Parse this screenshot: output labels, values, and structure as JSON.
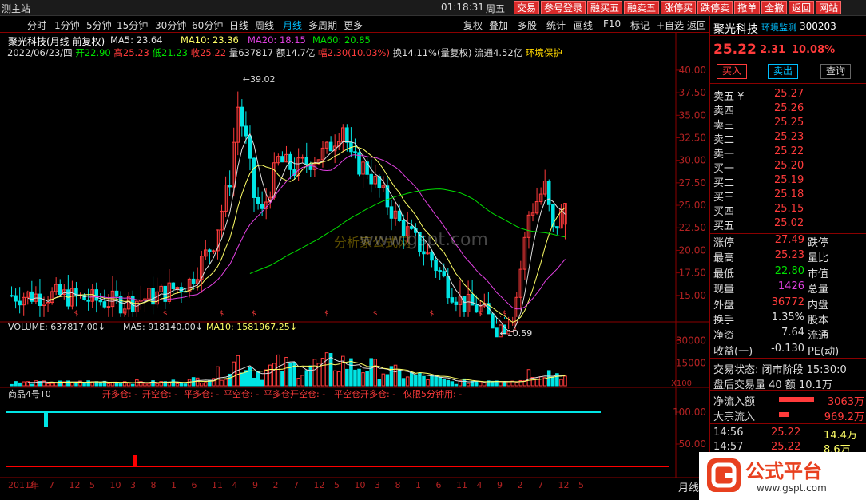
{
  "topbar": {
    "station": "测主站",
    "clock": "01:18:31",
    "weekday": "周五",
    "buttons": [
      "交易",
      "参号登录",
      "融买五",
      "融卖五",
      "涨停买",
      "跌停卖",
      "撤单",
      "全撤",
      "返回",
      "网站"
    ]
  },
  "periods": [
    {
      "label": "分时",
      "active": false
    },
    {
      "label": "1分钟",
      "active": false
    },
    {
      "label": "5分钟",
      "active": false
    },
    {
      "label": "15分钟",
      "active": false
    },
    {
      "label": "30分钟",
      "active": false
    },
    {
      "label": "60分钟",
      "active": false
    },
    {
      "label": "日线",
      "active": false
    },
    {
      "label": "周线",
      "active": false
    },
    {
      "label": "月线",
      "active": true
    },
    {
      "label": "多周期",
      "active": false
    },
    {
      "label": "更多",
      "active": false
    },
    {
      "label": "复权",
      "active": false
    },
    {
      "label": "叠加",
      "active": false
    },
    {
      "label": "多股",
      "active": false
    },
    {
      "label": "统计",
      "active": false
    },
    {
      "label": "画线",
      "active": false
    },
    {
      "label": "F10",
      "active": false
    },
    {
      "label": "标记",
      "active": false
    },
    {
      "label": "+自选",
      "active": false
    },
    {
      "label": "返回",
      "active": false
    }
  ],
  "chart_header": {
    "title": "聚光科技(月线 前复权)",
    "ma5": "MA5: 23.64",
    "ma10": "MA10: 23.36",
    "ma20": "MA20: 18.15",
    "ma60": "MA60: 20.85",
    "date": "2022/06/23/四",
    "open": "开22.90",
    "high": "高25.23",
    "low": "低21.23",
    "close": "收25.22",
    "volume": "量637817",
    "amount": "额14.7亿",
    "range": "幅2.30(10.03%)",
    "turnover": "换14.11%(量复权)",
    "float": "流通4.52亿",
    "env": "环境保护"
  },
  "watermark": {
    "site": "www.gspt.com",
    "text": "分析家公式网",
    "brand": "公式平台",
    "url": "www.gspt.com"
  },
  "volume_header": {
    "label": "VOLUME: 637817.00",
    "ma5": "MA5: 918140.00",
    "ma10": "MA10: 1581967.25"
  },
  "signal_header": {
    "label": "商品4号T0",
    "items": [
      "开多仓: -",
      "开空仓: -",
      "平多仓: -",
      "平空仓: -",
      "平多仓开空仓: -",
      "平空仓开多仓: -",
      "仅限5分钟用: -"
    ]
  },
  "chart_data": {
    "type": "candlestick",
    "title": "聚光科技(月线 前复权)",
    "ylim": [
      12.5,
      41.5
    ],
    "y_ticks": [
      15.0,
      17.5,
      20.0,
      22.5,
      25.0,
      27.5,
      30.0,
      32.5,
      35.0,
      37.5,
      40.0
    ],
    "annotations": [
      {
        "text": "39.02",
        "value": 39.02
      },
      {
        "text": "10.59",
        "value": 10.59
      }
    ],
    "volume_ticks": [
      15000,
      30000
    ],
    "volume_unit": "X100",
    "signal_ticks": [
      50.0,
      100.0
    ],
    "x_labels": [
      "2011年",
      "2",
      "7",
      "12",
      "5",
      "10",
      "3",
      "8",
      "1",
      "6",
      "11",
      "4",
      "9",
      "2",
      "7",
      "12",
      "5",
      "10",
      "3",
      "8",
      "1",
      "6",
      "11",
      "4",
      "9",
      "2",
      "7",
      "12",
      "5"
    ],
    "ohlc": []
  },
  "right_panel": {
    "name": "聚光科技",
    "env": "环境监测",
    "code": "300203",
    "price": "25.22",
    "change": "2.31",
    "pct": "10.08%",
    "buttons": [
      "买入",
      "卖出",
      "查询"
    ],
    "asks": [
      {
        "label": "卖五 ¥",
        "price": "25.27"
      },
      {
        "label": "卖四",
        "price": "25.26"
      },
      {
        "label": "卖三",
        "price": "25.25"
      },
      {
        "label": "卖二",
        "price": "25.23"
      },
      {
        "label": "卖一",
        "price": "25.22"
      }
    ],
    "bids": [
      {
        "label": "买一",
        "price": "25.20"
      },
      {
        "label": "买二",
        "price": "25.19"
      },
      {
        "label": "买三",
        "price": "25.18"
      },
      {
        "label": "买四",
        "price": "25.15"
      },
      {
        "label": "买五",
        "price": "25.02"
      }
    ],
    "stats": [
      {
        "l1": "涨停",
        "v1": "27.49",
        "c1": "#ff3b3b",
        "l2": "跌停"
      },
      {
        "l1": "最高",
        "v1": "25.23",
        "c1": "#ff3b3b",
        "l2": "量比"
      },
      {
        "l1": "最低",
        "v1": "22.80",
        "c1": "#00e000",
        "l2": "市值"
      },
      {
        "l1": "现量",
        "v1": "1426",
        "c1": "#e040e0",
        "l2": "总量"
      },
      {
        "l1": "外盘",
        "v1": "36772",
        "c1": "#ff3b3b",
        "l2": "内盘"
      },
      {
        "l1": "换手",
        "v1": "1.35%",
        "c1": "#ddd",
        "l2": "股本"
      },
      {
        "l1": "净资",
        "v1": "7.64",
        "c1": "#ddd",
        "l2": "流通"
      },
      {
        "l1": "收益(一)",
        "v1": "-0.130",
        "c1": "#ddd",
        "l2": "PE(动)"
      }
    ],
    "status": "交易状态: 闭市阶段 15:30:0",
    "after": "盘后交易量 40 额 10.1万",
    "netflow": {
      "label": "净流入额",
      "value": "3063万"
    },
    "bigflow": {
      "label": "大宗流入",
      "value": "969.2万"
    },
    "ticks": [
      {
        "time": "14:56",
        "price": "25.22",
        "vol": "14.4万"
      },
      {
        "time": "14:57",
        "price": "25.22",
        "vol": "8.6万"
      }
    ],
    "bottom_tab": "月线"
  }
}
